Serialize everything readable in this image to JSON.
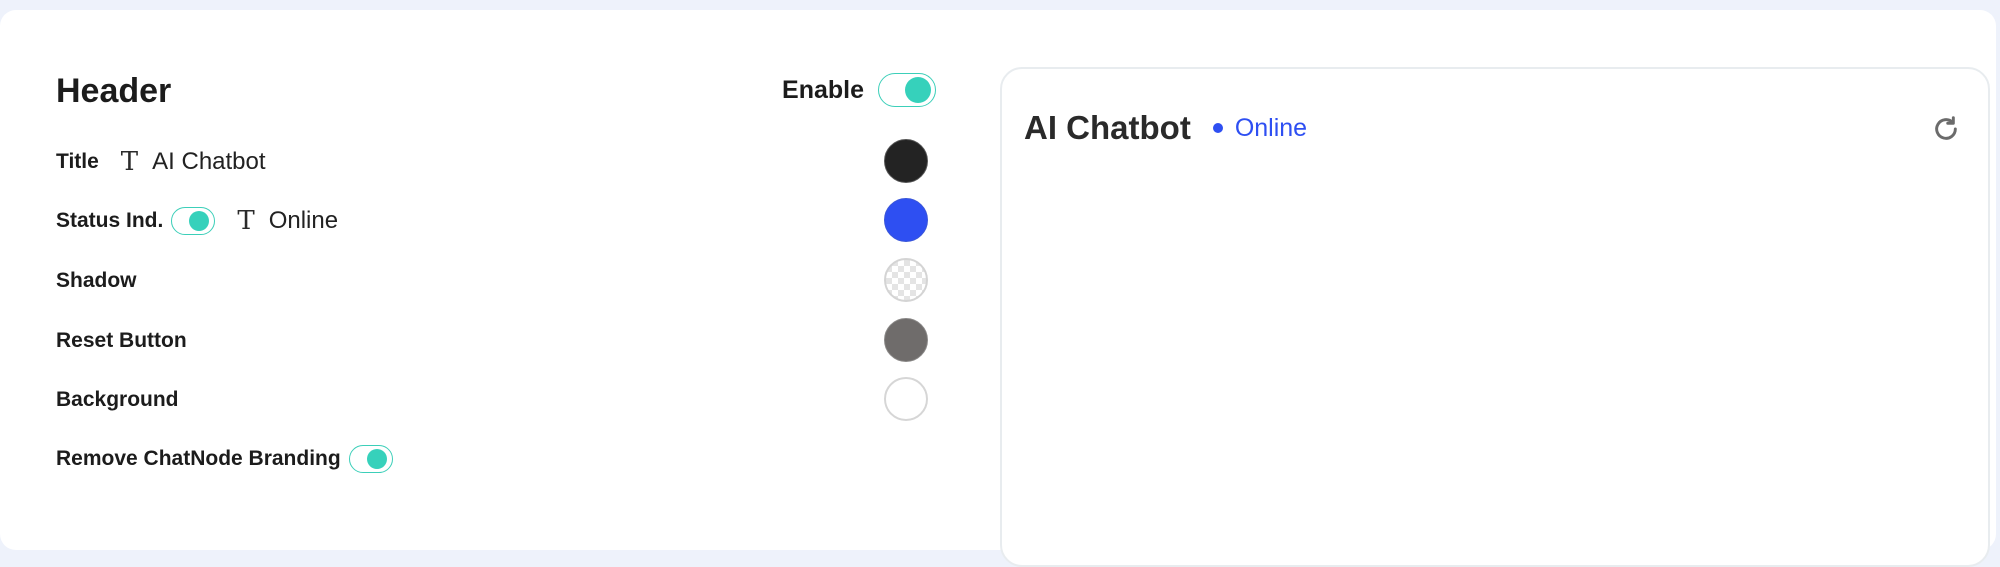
{
  "header": {
    "title": "Header",
    "enable_label": "Enable",
    "enabled": true
  },
  "rows": {
    "title": {
      "label": "Title",
      "icon": "text-type-icon",
      "value": "AI Chatbot",
      "color": "#232323"
    },
    "status": {
      "label": "Status Ind.",
      "enabled": true,
      "icon": "text-type-icon",
      "value": "Online",
      "color": "#2e4ff2"
    },
    "shadow": {
      "label": "Shadow",
      "color": "transparent"
    },
    "reset_button": {
      "label": "Reset Button",
      "color": "#6f6c6b"
    },
    "background": {
      "label": "Background",
      "color": "#ffffff"
    },
    "branding": {
      "label": "Remove ChatNode Branding",
      "enabled": true
    }
  },
  "preview": {
    "title": "AI Chatbot",
    "status_text": "Online",
    "status_color": "#2e4ff2",
    "reset_icon": "refresh-icon"
  },
  "colors": {
    "accent": "#36d1bb",
    "border": "#3ccfb9"
  }
}
